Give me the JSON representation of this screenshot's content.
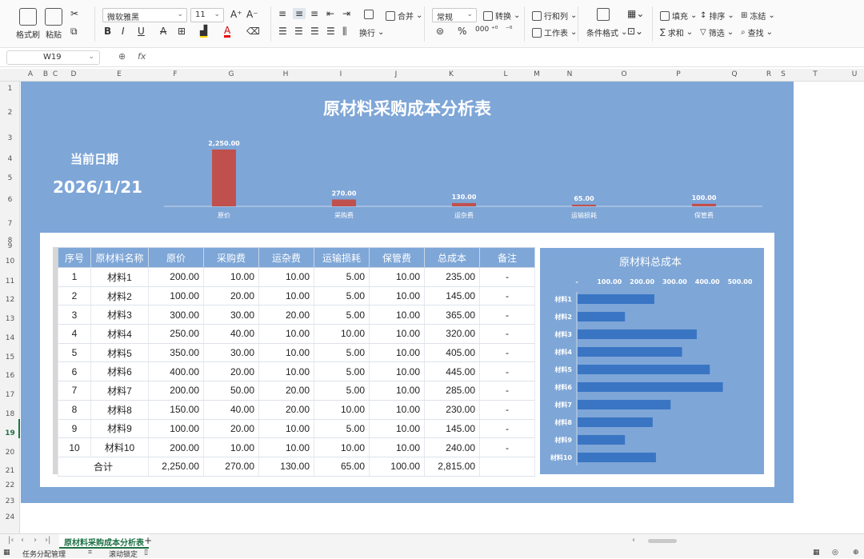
{
  "ribbon": {
    "format_painter": "格式刷",
    "paste": "粘贴",
    "font_name": "微软雅黑",
    "font_size": "11",
    "merge": "合并",
    "wrap": "换行",
    "number_format": "常规",
    "convert": "转换",
    "rows_cols": "行和列",
    "worksheet": "工作表",
    "cond_format": "条件格式",
    "fill": "填充",
    "sort": "排序",
    "freeze": "冻结",
    "sum": "求和",
    "filter": "筛选",
    "find": "查找"
  },
  "formula_bar": {
    "cell_ref": "W19",
    "fx": "fx"
  },
  "columns": [
    "A",
    "B",
    "C",
    "D",
    "E",
    "F",
    "G",
    "H",
    "I",
    "J",
    "K",
    "L",
    "M",
    "N",
    "O",
    "P",
    "Q",
    "R",
    "S",
    "T",
    "U"
  ],
  "rows": [
    "1",
    "2",
    "3",
    "4",
    "5",
    "6",
    "7",
    "8",
    "9",
    "10",
    "11",
    "12",
    "13",
    "14",
    "15",
    "16",
    "17",
    "18",
    "19",
    "20",
    "21",
    "22",
    "23",
    "24"
  ],
  "dashboard": {
    "title": "原材料采购成本分析表",
    "date_label": "当前日期",
    "date_value": "2026/1/21"
  },
  "table": {
    "headers": [
      "序号",
      "原材料名称",
      "原价",
      "采购费",
      "运杂费",
      "运输损耗",
      "保管费",
      "总成本",
      "备注"
    ],
    "rows": [
      [
        "1",
        "材料1",
        "200.00",
        "10.00",
        "10.00",
        "5.00",
        "10.00",
        "235.00",
        "-"
      ],
      [
        "2",
        "材料2",
        "100.00",
        "20.00",
        "10.00",
        "5.00",
        "10.00",
        "145.00",
        "-"
      ],
      [
        "3",
        "材料3",
        "300.00",
        "30.00",
        "20.00",
        "5.00",
        "10.00",
        "365.00",
        "-"
      ],
      [
        "4",
        "材料4",
        "250.00",
        "40.00",
        "10.00",
        "10.00",
        "10.00",
        "320.00",
        "-"
      ],
      [
        "5",
        "材料5",
        "350.00",
        "30.00",
        "10.00",
        "5.00",
        "10.00",
        "405.00",
        "-"
      ],
      [
        "6",
        "材料6",
        "400.00",
        "20.00",
        "10.00",
        "5.00",
        "10.00",
        "445.00",
        "-"
      ],
      [
        "7",
        "材料7",
        "200.00",
        "50.00",
        "20.00",
        "5.00",
        "10.00",
        "285.00",
        "-"
      ],
      [
        "8",
        "材料8",
        "150.00",
        "40.00",
        "20.00",
        "10.00",
        "10.00",
        "230.00",
        "-"
      ],
      [
        "9",
        "材料9",
        "100.00",
        "20.00",
        "10.00",
        "5.00",
        "10.00",
        "145.00",
        "-"
      ],
      [
        "10",
        "材料10",
        "200.00",
        "10.00",
        "10.00",
        "10.00",
        "10.00",
        "240.00",
        "-"
      ]
    ],
    "total_label": "合计",
    "totals": [
      "2,250.00",
      "270.00",
      "130.00",
      "65.00",
      "100.00",
      "2,815.00",
      ""
    ]
  },
  "chart_data": [
    {
      "type": "bar",
      "categories": [
        "原价",
        "采购费",
        "运杂费",
        "运输损耗",
        "保管费"
      ],
      "values": [
        2250,
        270,
        130,
        65,
        100
      ],
      "value_labels": [
        "2,250.00",
        "270.00",
        "130.00",
        "65.00",
        "100.00"
      ],
      "ylim": [
        0,
        2250
      ],
      "color": "#c0504d",
      "axis_color": "#c8d7ea"
    },
    {
      "type": "bar",
      "orientation": "horizontal",
      "title": "原材料总成本",
      "categories": [
        "材料1",
        "材料2",
        "材料3",
        "材料4",
        "材料5",
        "材料6",
        "材料7",
        "材料8",
        "材料9",
        "材料10"
      ],
      "values": [
        235,
        145,
        365,
        320,
        405,
        445,
        285,
        230,
        145,
        240
      ],
      "x_ticks": [
        "-",
        "100.00",
        "200.00",
        "300.00",
        "400.00",
        "500.00"
      ],
      "xlim": [
        0,
        500
      ],
      "color": "#3a75c4"
    }
  ],
  "sheet_tabs": {
    "active": "原材料采购成本分析表",
    "add": "+"
  },
  "status": {
    "task": "任务分配管理",
    "scroll": "滚动锁定"
  }
}
